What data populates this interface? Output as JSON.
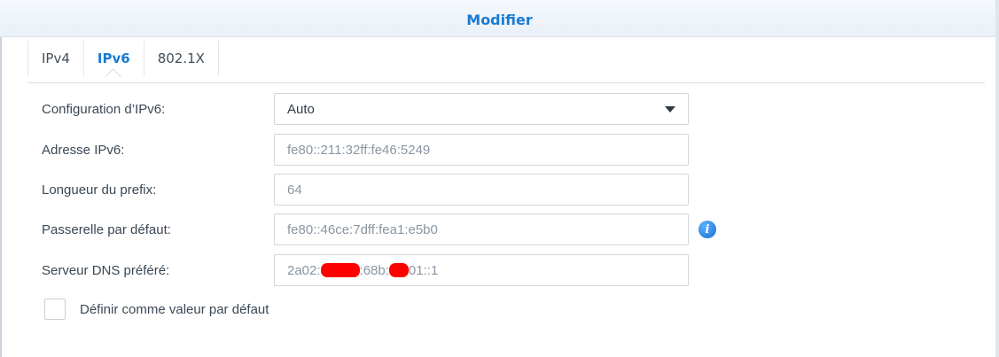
{
  "dialog": {
    "title": "Modifier"
  },
  "tabs": [
    {
      "label": "IPv4",
      "active": false
    },
    {
      "label": "IPv6",
      "active": true
    },
    {
      "label": "802.1X",
      "active": false
    }
  ],
  "form": {
    "ipv6_config": {
      "label": "Configuration d’IPv6:",
      "value": "Auto"
    },
    "ipv6_address": {
      "label": "Adresse IPv6:",
      "value": "fe80::211:32ff:fe46:5249"
    },
    "prefix_length": {
      "label": "Longueur du prefix:",
      "value": "64"
    },
    "default_gateway": {
      "label": "Passerelle par défaut:",
      "value": "fe80::46ce:7dff:fea1:e5b0"
    },
    "preferred_dns": {
      "label": "Serveur DNS préféré:",
      "value_part1": "2a02:",
      "value_part2": ":68b:",
      "value_part3": "01::1"
    },
    "set_default": {
      "label": "Définir comme valeur par défaut",
      "checked": false
    }
  },
  "colors": {
    "accent": "#1a7ad4",
    "redaction": "#ff0000"
  },
  "icons": {
    "gateway_info": "info-icon",
    "config_dropdown": "caret-down-icon"
  }
}
